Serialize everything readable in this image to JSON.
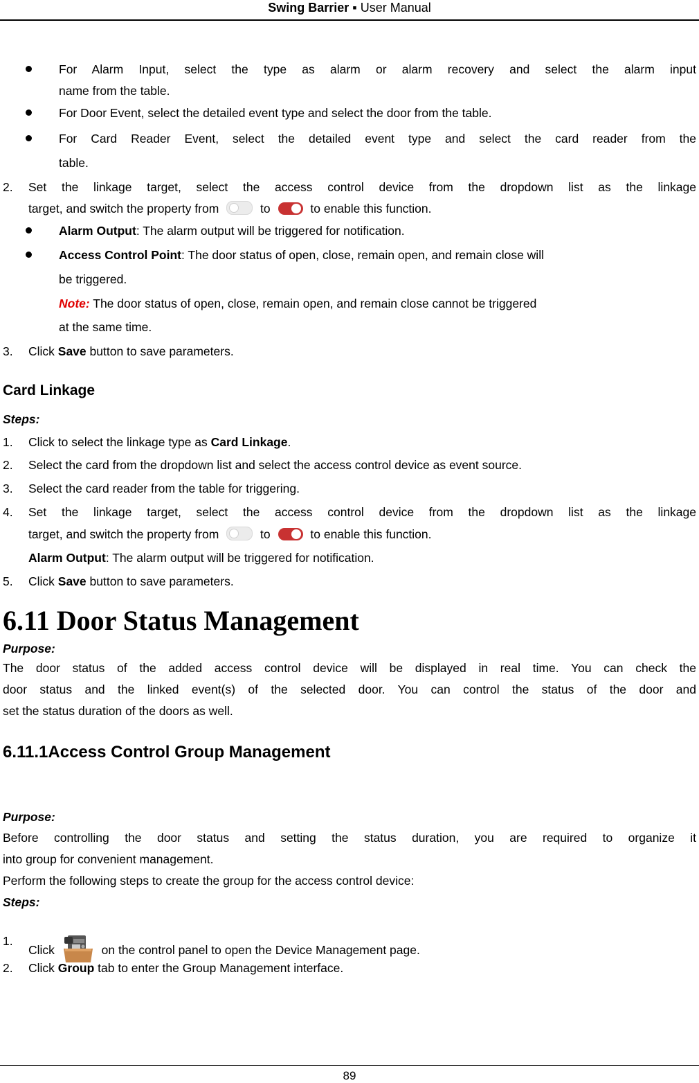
{
  "header": {
    "title_bold": "Swing Barrier",
    "separator": "▪",
    "title_rest": "User Manual"
  },
  "page_number": "89",
  "bullets_top": [
    {
      "line1": "For Alarm Input, select the type as alarm or alarm recovery and select the alarm input",
      "line2": "name from the table."
    },
    {
      "line1": "For Door Event, select the detailed event type and select the door from the table."
    },
    {
      "line1": "For Card Reader Event, select the detailed event type and select the card reader from the",
      "line2": "table."
    }
  ],
  "step2": {
    "num": "2.",
    "line1": "Set the linkage target, select the access control device from the dropdown list as the linkage",
    "line2_a": "target, and switch the property from",
    "line2_b": "to",
    "line2_c": "to enable this function."
  },
  "step2_bullets": [
    {
      "bold": "Alarm Output",
      "text": ": The alarm output will be triggered for notification."
    },
    {
      "bold": "Access Control Point",
      "text": ": The door status of open, close, remain open, and remain close will",
      "line2": "be triggered."
    }
  ],
  "note": {
    "label": "Note:",
    "line1": " The door status of open, close, remain open, and remain close cannot be triggered",
    "line2": "at the same time."
  },
  "step3": {
    "num": "3.",
    "pre": "Click ",
    "bold": "Save",
    "post": " button to save parameters."
  },
  "card_linkage": {
    "heading": "Card Linkage",
    "steps_label": "Steps:",
    "step1": {
      "num": "1.",
      "pre": "Click to select the linkage type as ",
      "bold": "Card Linkage",
      "post": "."
    },
    "step2": {
      "num": "2.",
      "text": "Select the card from the dropdown list and select the access control device as event source."
    },
    "step3": {
      "num": "3.",
      "text": "Select the card reader from the table for triggering."
    },
    "step4": {
      "num": "4.",
      "line1": "Set the linkage target, select the access control device from the dropdown list as the linkage",
      "line2_a": "target, and switch the property from",
      "line2_b": "to",
      "line2_c": "to enable this function.",
      "sub_bold": "Alarm Output",
      "sub_text": ": The alarm output will be triggered for notification."
    },
    "step5": {
      "num": "5.",
      "pre": "Click ",
      "bold": "Save",
      "post": " button to save parameters."
    }
  },
  "section": {
    "title": "6.11 Door Status Management",
    "purpose_label": "Purpose:",
    "purpose_lines": [
      "The door status of the added access control device will be displayed in real time. You can check the",
      "door status and the linked event(s) of the selected door. You can control the status of the door and",
      "set the status duration of the doors as well."
    ]
  },
  "subsection": {
    "title": "6.11.1Access Control Group Management",
    "purpose_label": "Purpose:",
    "purpose_lines": [
      "Before controlling the door status and setting the status duration, you are required to organize it",
      "into group for convenient management.",
      "Perform the following steps to create the group for the access control device:"
    ],
    "steps_label": "Steps:",
    "step1": {
      "num": "1.",
      "pre": "Click",
      "post": "on the control panel to open the Device Management page.",
      "icon": "device-management-icon"
    },
    "step2": {
      "num": "2.",
      "pre": "Click ",
      "bold": "Group",
      "post": " tab to enter the Group Management interface."
    }
  },
  "colors": {
    "note_red": "#e00000",
    "toggle_on": "#c83232",
    "toggle_off": "#ececec"
  }
}
